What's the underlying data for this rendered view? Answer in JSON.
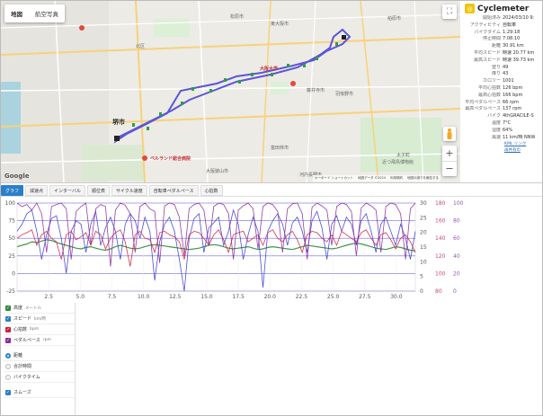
{
  "map": {
    "tabs": [
      "地図",
      "航空写真"
    ],
    "active_tab": 0,
    "labels": [
      {
        "text": "堺市",
        "kind": "big"
      },
      {
        "text": "北区",
        "kind": "normal"
      },
      {
        "text": "東大阪市",
        "kind": "normal"
      },
      {
        "text": "松原市",
        "kind": "normal"
      },
      {
        "text": "柏原市",
        "kind": "normal"
      },
      {
        "text": "羽曳野市",
        "kind": "normal"
      },
      {
        "text": "藤井寺市",
        "kind": "normal"
      },
      {
        "text": "大阪狭山市",
        "kind": "normal"
      },
      {
        "text": "富田林市",
        "kind": "normal"
      },
      {
        "text": "太子町",
        "kind": "normal"
      },
      {
        "text": "河内長野市",
        "kind": "normal"
      },
      {
        "text": "大阪大学",
        "kind": "red"
      },
      {
        "text": "ベルランド総合病院",
        "kind": "red"
      },
      {
        "text": "近つ飛鳥博物館",
        "kind": "normal"
      }
    ],
    "attribution": [
      "キーボード ショートカット",
      "地図データ ©2024",
      "利用規約",
      "地図の誤りを報告する"
    ],
    "google_label": "Google"
  },
  "info": {
    "title": "Cyclemeter",
    "rows": [
      {
        "k": "開始済み",
        "v": "2024/03/10 9:"
      },
      {
        "k": "アクティビティ",
        "v": "自転車"
      },
      {
        "k": "バイクタイム",
        "v": "1:29:18"
      },
      {
        "k": "停止時間",
        "v": "7:08:10"
      },
      {
        "k": "距離",
        "v": "30.91 km"
      },
      {
        "k": "平均スピード",
        "v": "時速 20.77 km"
      },
      {
        "k": "最高スピード",
        "v": "時速 39.73 km"
      },
      {
        "k": "登り",
        "v": "49"
      },
      {
        "k": "降り",
        "v": "43"
      },
      {
        "k": "カロリー",
        "v": "1001"
      },
      {
        "k": "平均心拍数",
        "v": "126 bpm"
      },
      {
        "k": "最高心拍数",
        "v": "166 bpm"
      },
      {
        "k": "平均ペダルペース",
        "v": "66 rpm"
      },
      {
        "k": "最高ペダルペース",
        "v": "137 rpm"
      },
      {
        "k": "バイク",
        "v": "4thGRACILE-S"
      },
      {
        "k": "温度",
        "v": "7°C"
      },
      {
        "k": "湿度",
        "v": "64%"
      },
      {
        "k": "風速",
        "v": "11 km/時 NNW"
      }
    ],
    "links": [
      "KML リンク",
      "再共有の"
    ]
  },
  "tabs": [
    "グラフ",
    "減速点",
    "インターバル",
    "順位表",
    "サイクル速度",
    "自転車ペダルペース",
    "心拍数"
  ],
  "active_tab": 0,
  "chart_data": {
    "type": "line",
    "xlim": [
      0,
      31.5
    ],
    "x_ticks": [
      "2.5",
      "5.0",
      "7.5",
      "10.0",
      "12.5",
      "15.0",
      "17.5",
      "20.0",
      "22.5",
      "25.0",
      "27.5",
      "30.0"
    ],
    "left_axis": {
      "ticks": [
        "100",
        "75",
        "50",
        "25",
        "0",
        "-25"
      ],
      "ylim": [
        -25,
        100
      ]
    },
    "right_axes": [
      {
        "ticks": [
          "30",
          "25",
          "20",
          "15",
          "10",
          "5",
          "0"
        ],
        "ylim": [
          0,
          30
        ]
      },
      {
        "ticks": [
          "180",
          "160",
          "140",
          "120",
          "100",
          "80"
        ],
        "ylim": [
          80,
          180
        ]
      },
      {
        "ticks": [
          "100",
          "80",
          "60",
          "40",
          "20",
          "0"
        ],
        "ylim": [
          0,
          100
        ]
      }
    ],
    "series": [
      {
        "name": "高度",
        "color": "#2e8b3a",
        "values": [
          38,
          40,
          42,
          45,
          44,
          46,
          48,
          47,
          44,
          42,
          40,
          38,
          36,
          35,
          37,
          38,
          36,
          34,
          33,
          35,
          38,
          40,
          38,
          36,
          35,
          36,
          38,
          40,
          41,
          40,
          39,
          38,
          37,
          36,
          35,
          34,
          35,
          36,
          38,
          40,
          41,
          40,
          38,
          36,
          35,
          36,
          37,
          38,
          36,
          34,
          35,
          37,
          38,
          37,
          36,
          35,
          34,
          36,
          38,
          40,
          39,
          38,
          37,
          36,
          35,
          36,
          38,
          40,
          42,
          43,
          42,
          40,
          38,
          36,
          35,
          34,
          36,
          38,
          37,
          35,
          33,
          32
        ]
      },
      {
        "name": "スピード",
        "color": "#3b3bd1",
        "values": [
          60,
          70,
          85,
          90,
          60,
          20,
          55,
          78,
          82,
          50,
          0,
          60,
          75,
          70,
          30,
          70,
          88,
          40,
          65,
          80,
          60,
          20,
          70,
          85,
          75,
          50,
          80,
          60,
          -10,
          45,
          70,
          80,
          60,
          20,
          -25,
          50,
          78,
          85,
          30,
          65,
          72,
          80,
          40,
          60,
          90,
          70,
          20,
          55,
          80,
          60,
          -20,
          60,
          75,
          85,
          70,
          40,
          72,
          80,
          60,
          30,
          75,
          88,
          65,
          20,
          70,
          82,
          60,
          80,
          70,
          40,
          75,
          85,
          60,
          30,
          70,
          80,
          60,
          40,
          70,
          50,
          20,
          60
        ]
      },
      {
        "name": "心拍数",
        "color": "#d11b3e",
        "values": [
          50,
          55,
          58,
          62,
          40,
          55,
          60,
          50,
          45,
          20,
          55,
          60,
          48,
          52,
          58,
          40,
          60,
          55,
          35,
          50,
          58,
          62,
          45,
          10,
          55,
          60,
          50,
          48,
          30,
          58,
          60,
          55,
          52,
          45,
          20,
          55,
          60,
          58,
          50,
          40,
          55,
          62,
          48,
          30,
          55,
          58,
          60,
          45,
          50,
          55,
          40,
          58,
          62,
          50,
          45,
          55,
          60,
          48,
          30,
          55,
          60,
          58,
          50,
          45,
          55,
          40,
          60,
          55,
          50,
          45,
          58,
          62,
          50,
          40,
          55,
          58,
          48,
          35,
          50,
          55,
          45,
          30
        ]
      },
      {
        "name": "ペダルペース",
        "color": "#8b2a9c",
        "values": [
          100,
          95,
          98,
          90,
          100,
          85,
          30,
          95,
          98,
          100,
          92,
          20,
          88,
          95,
          100,
          40,
          92,
          98,
          95,
          10,
          90,
          100,
          97,
          85,
          30,
          95,
          100,
          92,
          88,
          15,
          96,
          100,
          98,
          80,
          25,
          92,
          98,
          100,
          90,
          40,
          95,
          100,
          98,
          85,
          20,
          90,
          96,
          100,
          92,
          35,
          95,
          100,
          98,
          88,
          30,
          92,
          99,
          100,
          85,
          20,
          94,
          100,
          96,
          90,
          40,
          95,
          100,
          98,
          88,
          25,
          93,
          100,
          96,
          90,
          30,
          95,
          100,
          98,
          85,
          20,
          92,
          100
        ]
      }
    ]
  },
  "legend": {
    "series": [
      {
        "label": "高度",
        "unit": "メートル",
        "color": "#2e8b3a"
      },
      {
        "label": "スピード",
        "unit": "km/時",
        "color": "#2a7fc9"
      },
      {
        "label": "心拍数",
        "unit": "bpm",
        "color": "#d11b3e"
      },
      {
        "label": "ペダルペース",
        "unit": "rpm",
        "color": "#8b2a9c"
      }
    ],
    "x_modes": [
      "距離",
      "合計時間",
      "バイクタイム"
    ],
    "selected_mode": 0,
    "smooth_label": "スムーズ"
  }
}
